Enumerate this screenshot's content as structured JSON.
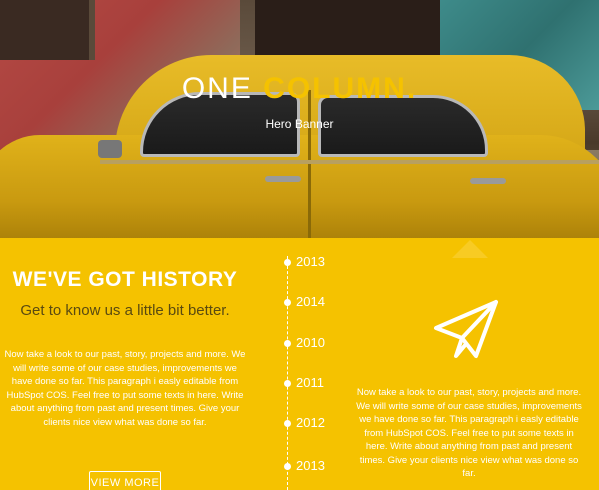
{
  "hero": {
    "title_plain": "ONE ",
    "title_accent": "COLUMN",
    "title_dot": ".",
    "subtitle": "Hero Banner"
  },
  "history": {
    "title": "WE'VE GOT HISTORY",
    "subtitle": "Get to know us a little bit better.",
    "body": "Now take a look to our past, story, projects and more. We will write some of our case studies, improvements we have done so far. This paragraph i easly editable from HubSpot COS. Feel free to put some texts in here. Write about anything from past and present times. Give your clients nice view what was done so far.",
    "button_label": "VIEW MORE"
  },
  "timeline": {
    "years": [
      "2013",
      "2014",
      "2010",
      "2011",
      "2012",
      "2013"
    ]
  },
  "right_panel": {
    "icon": "paper-plane-icon",
    "body": "Now take a look to our past, story, projects and more. We will write some of our case studies, improvements we have done so far. This paragraph i easly editable from HubSpot COS. Feel free to put some texts in here. Write about anything from past and present times. Give your clients nice view what was done so far."
  },
  "colors": {
    "accent": "#f5c200",
    "text_dark": "#5a4a10",
    "white": "#ffffff"
  }
}
